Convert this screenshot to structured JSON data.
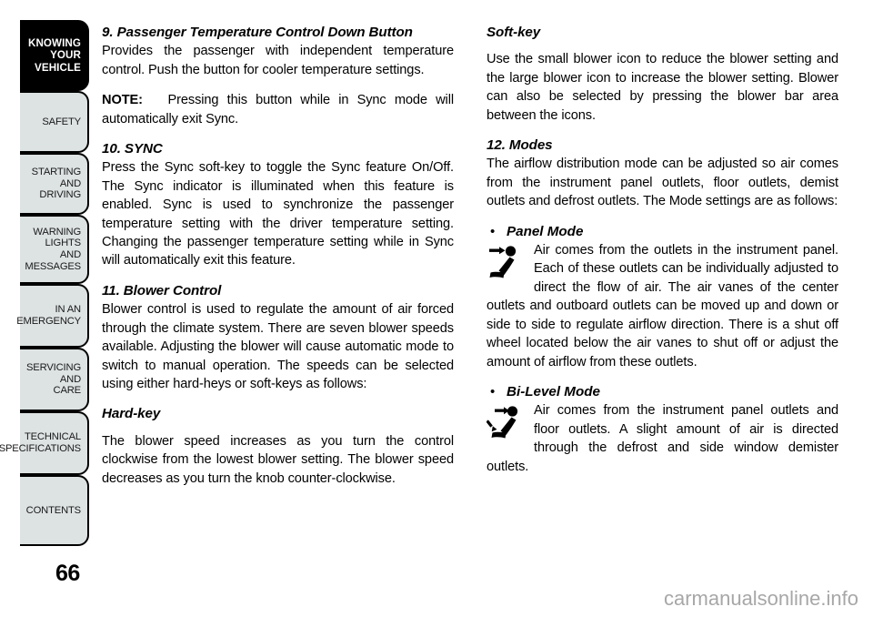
{
  "sidebar": {
    "tabs": [
      {
        "label": "KNOWING\nYOUR\nVEHICLE",
        "current": true
      },
      {
        "label": "SAFETY",
        "current": false
      },
      {
        "label": "STARTING\nAND\nDRIVING",
        "current": false
      },
      {
        "label": "WARNING\nLIGHTS\nAND\nMESSAGES",
        "current": false
      },
      {
        "label": "IN AN\nEMERGENCY",
        "current": false
      },
      {
        "label": "SERVICING\nAND\nCARE",
        "current": false
      },
      {
        "label": "TECHNICAL\nSPECIFICATIONS",
        "current": false
      },
      {
        "label": "CONTENTS",
        "current": false
      }
    ]
  },
  "page": {
    "number": "66",
    "watermark": "carmanualsonline.info",
    "colors": {
      "tab_fill": "#dde2e2",
      "tab_current_fill": "#000000",
      "text": "#000000",
      "watermark": "#a7a7a7"
    }
  },
  "left_column": {
    "section_9_heading": "9.  Passenger Temperature Control Down Button",
    "section_9_body": "Provides the passenger with independent temperature control. Push the button for cooler temperature settings.",
    "note_label": "NOTE:",
    "note_body": "Pressing this button while in Sync mode will automatically exit Sync.",
    "section_10_heading": "10.  SYNC",
    "section_10_body": "Press the Sync soft-key to toggle the Sync feature On/Off. The Sync indicator is illuminated when this feature is enabled. Sync is used to synchronize the passenger temperature setting with the driver temperature setting. Changing the passenger temperature setting while in Sync will automatically exit this feature.",
    "section_11_heading": "11.  Blower Control",
    "section_11_body": "Blower control is used to regulate the amount of air forced through the climate system. There are seven blower speeds available. Adjusting the blower will cause automatic mode to switch to manual operation. The speeds can be selected using either hard-heys or soft-keys as follows:",
    "hardkey_heading": "Hard-key",
    "hardkey_body": "The blower speed increases as you turn the control clockwise from the lowest blower setting. The blower speed decreases as you turn the knob counter-clockwise."
  },
  "right_column": {
    "softkey_heading": "Soft-key",
    "softkey_body": "Use the small blower icon to reduce the blower setting and the large blower icon to increase the blower setting. Blower can also be selected by pressing the blower bar area between the icons.",
    "section_12_heading": "12.  Modes",
    "section_12_body": "The airflow distribution mode can be adjusted so air comes from the instrument panel outlets, floor outlets, demist outlets and defrost outlets. The Mode settings are as follows:",
    "bullet": "•",
    "panel_mode_label": "Panel Mode",
    "panel_mode_body": "Air comes from the outlets in the instrument panel. Each of these outlets can be individually adjusted to direct the flow of air. The air vanes of the center outlets and outboard outlets can be moved up and down or side to side to regulate airflow direction. There is a shut off wheel located below the air vanes to shut off or adjust the amount of airflow from these outlets.",
    "bilevel_mode_label": "Bi-Level Mode",
    "bilevel_mode_body": "Air comes from the instrument panel outlets and floor outlets. A slight amount of air is directed through the defrost and side window demister outlets."
  }
}
